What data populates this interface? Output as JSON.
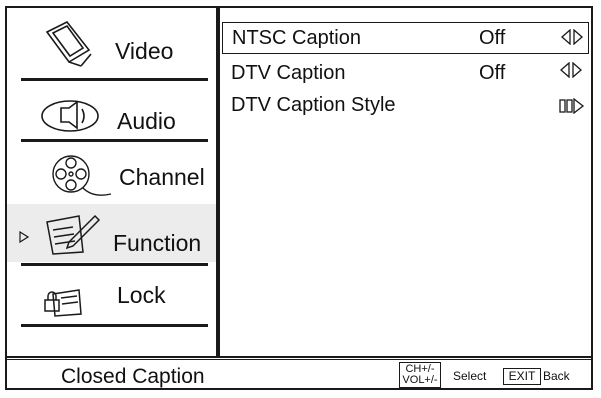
{
  "sidebar": {
    "items": [
      {
        "label": "Video",
        "icon": "video-icon"
      },
      {
        "label": "Audio",
        "icon": "audio-icon"
      },
      {
        "label": "Channel",
        "icon": "channel-icon"
      },
      {
        "label": "Function",
        "icon": "function-icon",
        "selected": true
      },
      {
        "label": "Lock",
        "icon": "lock-icon"
      }
    ]
  },
  "content": {
    "rows": [
      {
        "label": "NTSC Caption",
        "value": "Off",
        "control": "left-right-arrows-icon"
      },
      {
        "label": "DTV Caption",
        "value": "Off",
        "control": "left-right-arrows-icon"
      },
      {
        "label": "DTV Caption Style",
        "value": "",
        "control": "enter-arrow-icon"
      }
    ]
  },
  "footer": {
    "title": "Closed Caption",
    "select_key_line1": "CH+/-",
    "select_key_line2": "VOL+/-",
    "select_label": "Select",
    "back_key": "EXIT",
    "back_label": "Back"
  }
}
